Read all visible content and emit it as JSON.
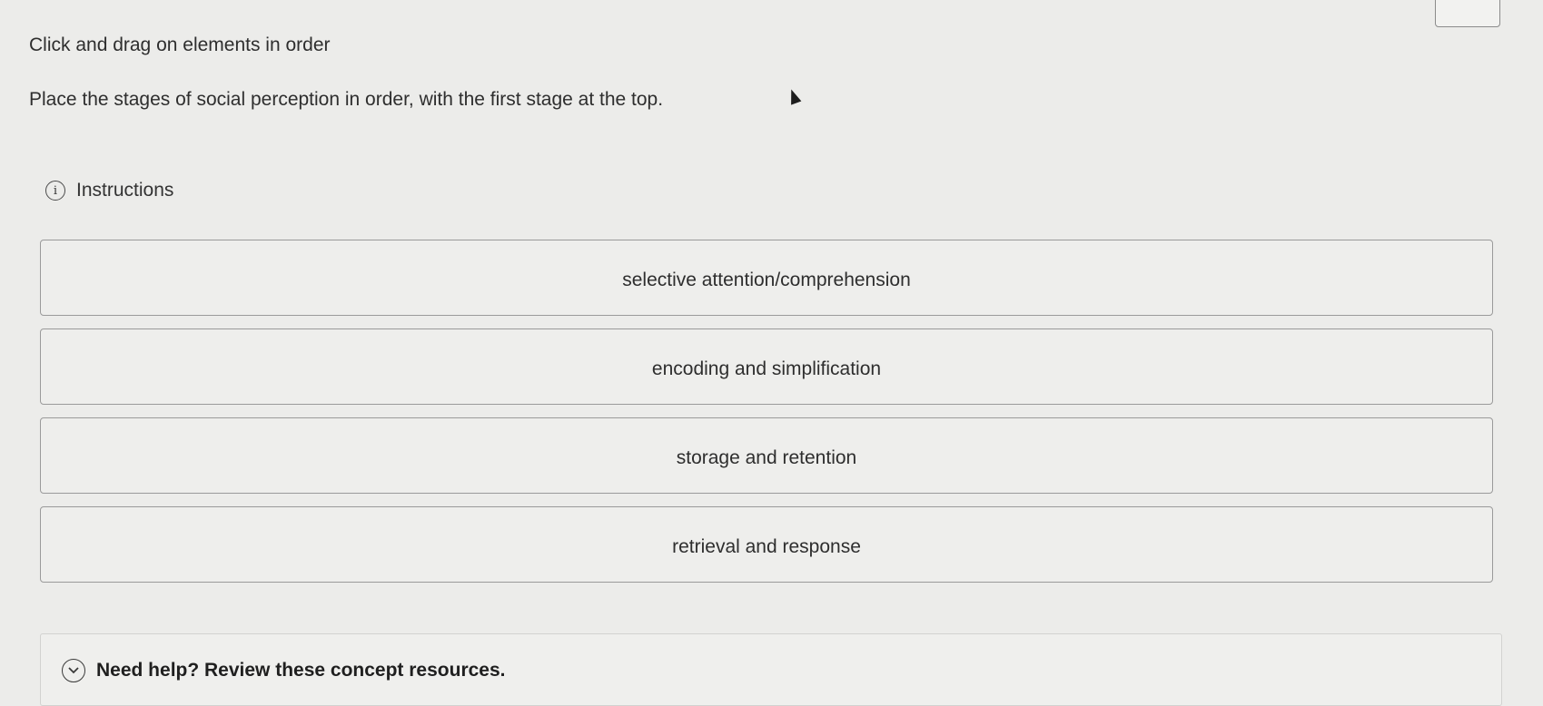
{
  "prompt": {
    "title": "Click and drag on elements in order",
    "text": "Place the stages of social perception in order, with the first stage at the top."
  },
  "instructions": {
    "icon": "info-icon",
    "label": "Instructions"
  },
  "items": [
    {
      "label": "selective attention/comprehension"
    },
    {
      "label": "encoding and simplification"
    },
    {
      "label": "storage and retention"
    },
    {
      "label": "retrieval and response"
    }
  ],
  "help": {
    "icon": "chevron-down-circle-icon",
    "label": "Need help? Review these concept resources."
  }
}
